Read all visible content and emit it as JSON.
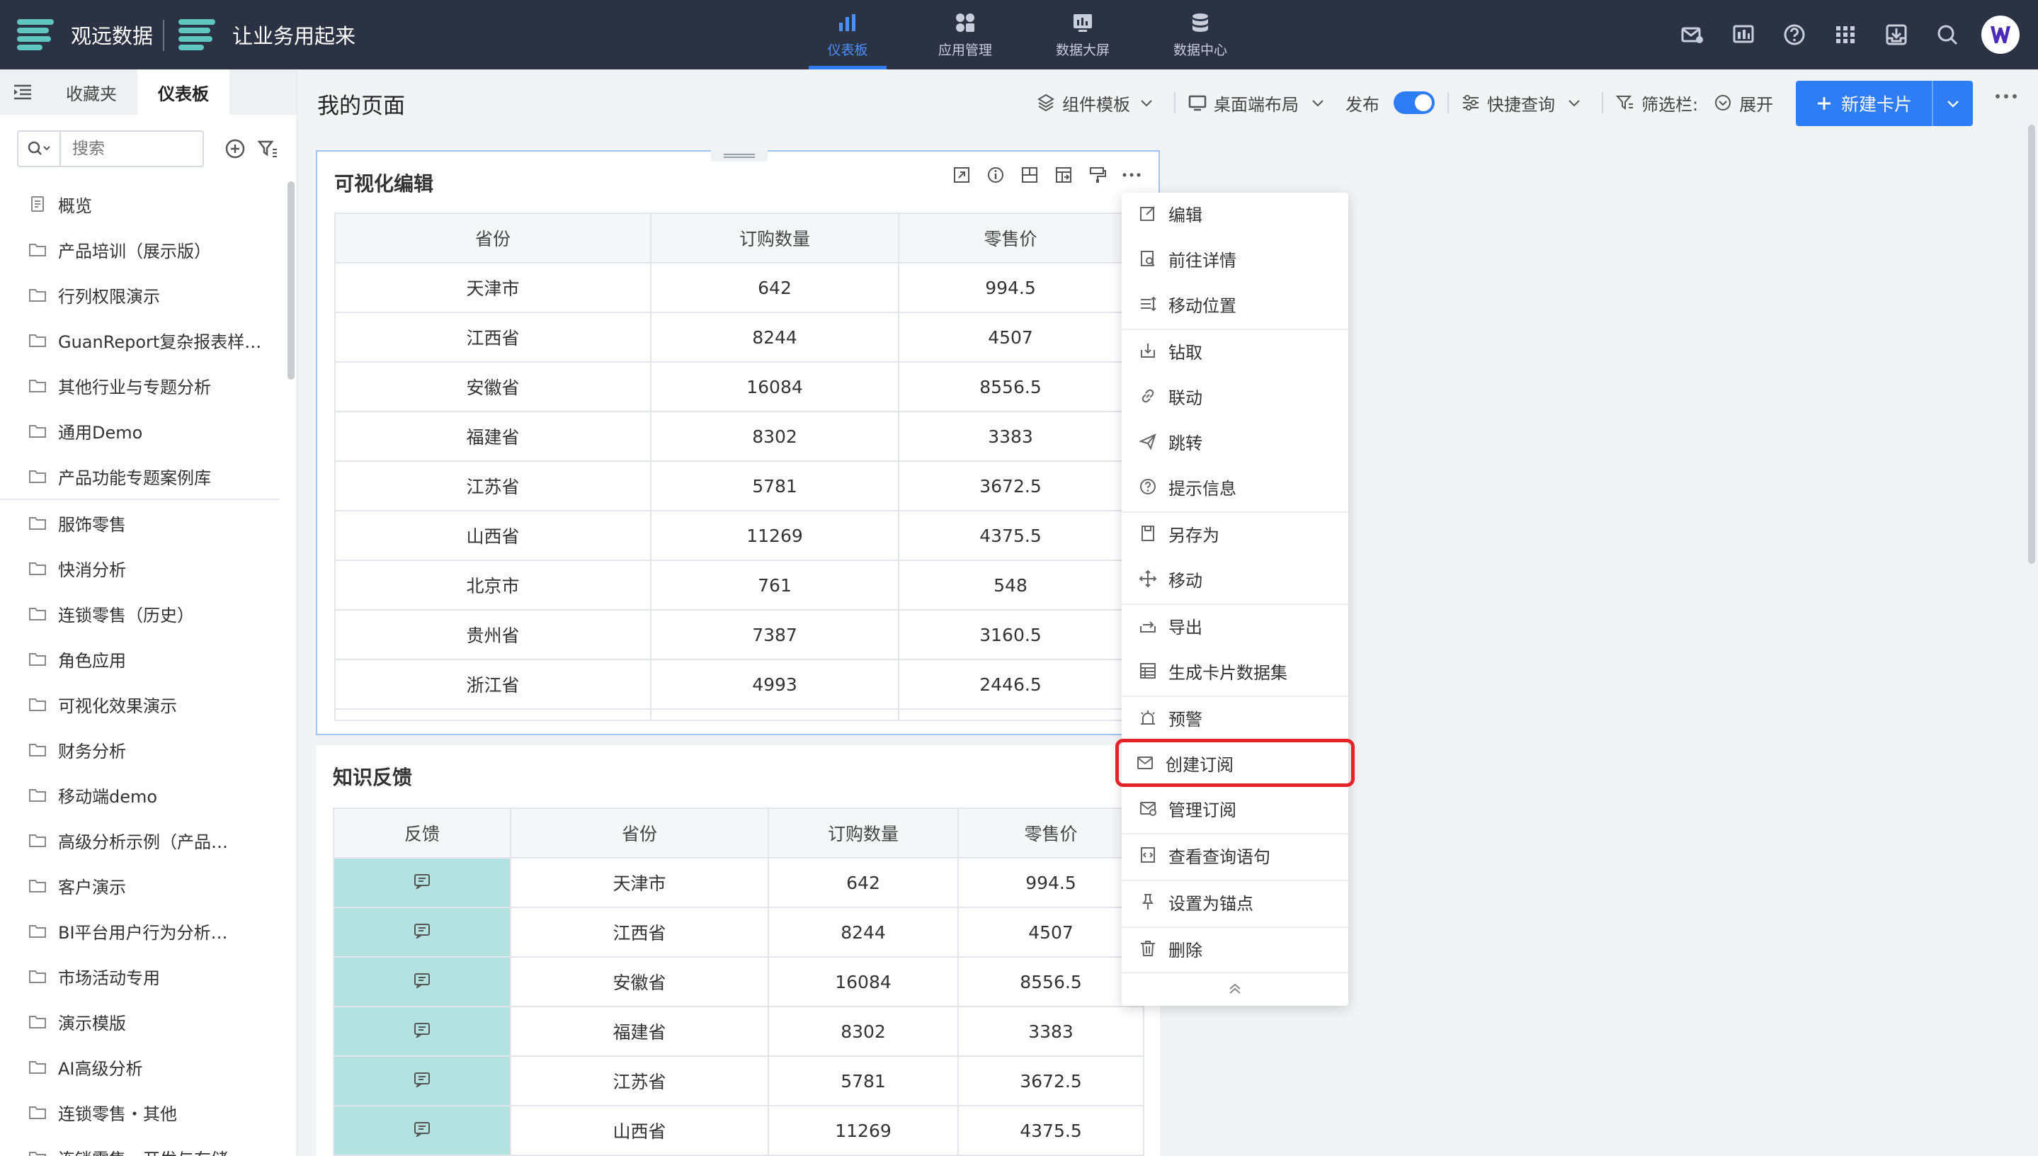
{
  "topbar": {
    "brand_name": "观远数据",
    "brand_slogan": "让业务用起来",
    "nav": [
      {
        "label": "仪表板",
        "icon": "bar-chart-icon",
        "active": true
      },
      {
        "label": "应用管理",
        "icon": "apps-cluster-icon",
        "active": false
      },
      {
        "label": "数据大屏",
        "icon": "big-screen-icon",
        "active": false
      },
      {
        "label": "数据中心",
        "icon": "database-icon",
        "active": false
      }
    ],
    "icons": [
      "mail-notify-icon",
      "screen-monitor-icon",
      "help-icon",
      "grid-apps-icon",
      "inbox-download-icon",
      "search-icon",
      "user-avatar-icon"
    ]
  },
  "sidebar": {
    "tabs": [
      "收藏夹",
      "仪表板"
    ],
    "active_tab": "仪表板",
    "search_placeholder": "搜索",
    "items": [
      {
        "label": "概览",
        "icon": "document-icon"
      },
      {
        "label": "产品培训（展示版）",
        "icon": "folder-icon"
      },
      {
        "label": "行列权限演示",
        "icon": "folder-icon"
      },
      {
        "label": "GuanReport复杂报表样…",
        "icon": "folder-icon"
      },
      {
        "label": "其他行业与专题分析",
        "icon": "folder-icon"
      },
      {
        "label": "通用Demo",
        "icon": "folder-icon"
      },
      {
        "label": "产品功能专题案例库",
        "icon": "folder-icon"
      },
      {
        "label": "服饰零售",
        "icon": "folder-icon"
      },
      {
        "label": "快消分析",
        "icon": "folder-icon"
      },
      {
        "label": "连锁零售（历史）",
        "icon": "folder-icon"
      },
      {
        "label": "角色应用",
        "icon": "folder-icon"
      },
      {
        "label": "可视化效果演示",
        "icon": "folder-icon"
      },
      {
        "label": "财务分析",
        "icon": "folder-icon"
      },
      {
        "label": "移动端demo",
        "icon": "folder-icon"
      },
      {
        "label": "高级分析示例（产品…",
        "icon": "folder-icon"
      },
      {
        "label": "客户演示",
        "icon": "folder-icon"
      },
      {
        "label": "BI平台用户行为分析…",
        "icon": "folder-icon"
      },
      {
        "label": "市场活动专用",
        "icon": "folder-icon"
      },
      {
        "label": "演示模版",
        "icon": "folder-icon"
      },
      {
        "label": "AI高级分析",
        "icon": "folder-icon"
      },
      {
        "label": "连锁零售・其他",
        "icon": "folder-icon"
      },
      {
        "label": "连锁零售・开发与存储",
        "icon": "folder-icon"
      }
    ]
  },
  "header": {
    "page_title": "我的页面",
    "component_template": "组件模板",
    "layout": "桌面端布局",
    "publish": "发布",
    "publish_on": true,
    "quick_query": "快捷查询",
    "filter_bar": "筛选栏:",
    "expand": "展开",
    "new_card": "新建卡片"
  },
  "card1": {
    "title": "可视化编辑",
    "columns": [
      "省份",
      "订购数量",
      "零售价"
    ],
    "rows": [
      [
        "天津市",
        "642",
        "994.5"
      ],
      [
        "江西省",
        "8244",
        "4507"
      ],
      [
        "安徽省",
        "16084",
        "8556.5"
      ],
      [
        "福建省",
        "8302",
        "3383"
      ],
      [
        "江苏省",
        "5781",
        "3672.5"
      ],
      [
        "山西省",
        "11269",
        "4375.5"
      ],
      [
        "北京市",
        "761",
        "548"
      ],
      [
        "贵州省",
        "7387",
        "3160.5"
      ],
      [
        "浙江省",
        "4993",
        "2446.5"
      ]
    ]
  },
  "card2": {
    "title": "知识反馈",
    "columns": [
      "反馈",
      "省份",
      "订购数量",
      "零售价"
    ],
    "rows": [
      [
        "天津市",
        "642",
        "994.5"
      ],
      [
        "江西省",
        "8244",
        "4507"
      ],
      [
        "安徽省",
        "16084",
        "8556.5"
      ],
      [
        "福建省",
        "8302",
        "3383"
      ],
      [
        "江苏省",
        "5781",
        "3672.5"
      ],
      [
        "山西省",
        "11269",
        "4375.5"
      ]
    ]
  },
  "context_menu": {
    "items": [
      {
        "label": "编辑",
        "icon": "edit-icon"
      },
      {
        "label": "前往详情",
        "icon": "detail-icon"
      },
      {
        "label": "移动位置",
        "icon": "reorder-icon"
      },
      {
        "label": "钻取",
        "icon": "drill-icon"
      },
      {
        "label": "联动",
        "icon": "link-icon"
      },
      {
        "label": "跳转",
        "icon": "send-icon"
      },
      {
        "label": "提示信息",
        "icon": "question-icon"
      },
      {
        "label": "另存为",
        "icon": "save-as-icon"
      },
      {
        "label": "移动",
        "icon": "move-icon"
      },
      {
        "label": "导出",
        "icon": "export-icon"
      },
      {
        "label": "生成卡片数据集",
        "icon": "dataset-icon"
      },
      {
        "label": "预警",
        "icon": "alarm-icon"
      },
      {
        "label": "创建订阅",
        "icon": "mail-icon"
      },
      {
        "label": "管理订阅",
        "icon": "mail-manage-icon"
      },
      {
        "label": "查看查询语句",
        "icon": "code-icon"
      },
      {
        "label": "设置为锚点",
        "icon": "pin-icon"
      },
      {
        "label": "删除",
        "icon": "trash-icon"
      }
    ],
    "highlighted": "创建订阅",
    "highlight_color": "#e5212a"
  },
  "colors": {
    "topbar_bg": "#2b3244",
    "accent": "#2f7df6",
    "brand_teal": "#5fc6c0",
    "feedback_cell": "#b3e2e0"
  }
}
